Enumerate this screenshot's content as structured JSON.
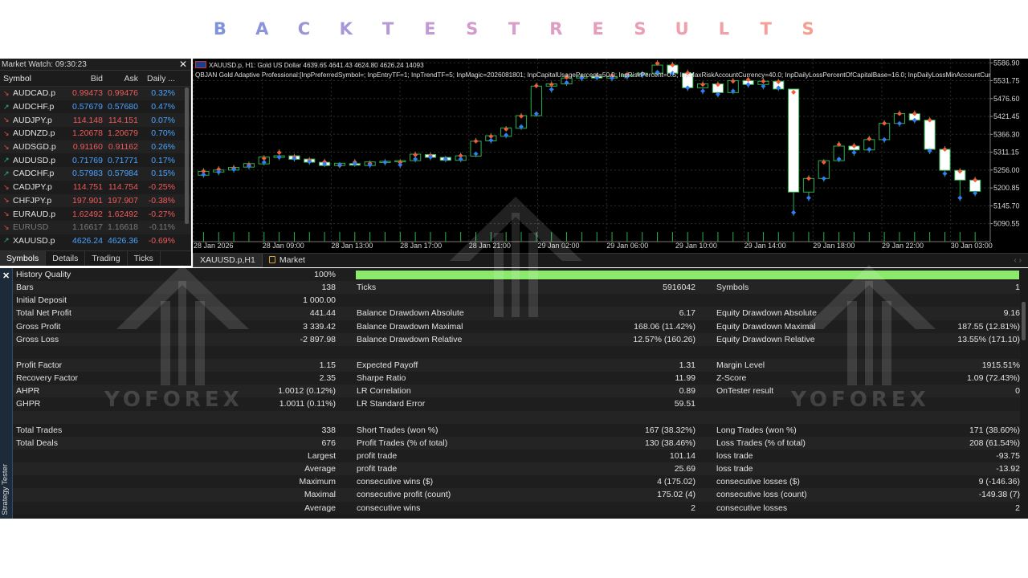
{
  "banner": {
    "letters": [
      "B",
      "A",
      "C",
      "K",
      "T",
      "E",
      "S",
      "T",
      "R",
      "E",
      "S",
      "U",
      "L",
      "T",
      "S"
    ],
    "colors": [
      "#7f93d8",
      "#8b94d8",
      "#9a95d8",
      "#a897d8",
      "#b598d6",
      "#c49ad4",
      "#d19bd0",
      "#d99ccb",
      "#e09dc4",
      "#e69ebd",
      "#eb9fb5",
      "#efa0ac",
      "#f2a0a3",
      "#f4a09a",
      "#f59f91"
    ]
  },
  "market_watch": {
    "title": "Market Watch: 09:30:23",
    "close": "✕",
    "headers": [
      "Symbol",
      "Bid",
      "Ask",
      "Daily ..."
    ],
    "rows": [
      {
        "dir": "dn",
        "symbol": "AUDCAD.p",
        "bid": "0.99473",
        "ask": "0.99476",
        "daily": "0.32%",
        "bidc": "neg",
        "askc": "neg",
        "dc": "pos"
      },
      {
        "dir": "up",
        "symbol": "AUDCHF.p",
        "bid": "0.57679",
        "ask": "0.57680",
        "daily": "0.47%",
        "bidc": "pos",
        "askc": "pos",
        "dc": "pos"
      },
      {
        "dir": "dn",
        "symbol": "AUDJPY.p",
        "bid": "114.148",
        "ask": "114.151",
        "daily": "0.07%",
        "bidc": "neg",
        "askc": "neg",
        "dc": "pos"
      },
      {
        "dir": "dn",
        "symbol": "AUDNZD.p",
        "bid": "1.20678",
        "ask": "1.20679",
        "daily": "0.70%",
        "bidc": "neg",
        "askc": "neg",
        "dc": "pos"
      },
      {
        "dir": "dn",
        "symbol": "AUDSGD.p",
        "bid": "0.91160",
        "ask": "0.91162",
        "daily": "0.26%",
        "bidc": "neg",
        "askc": "neg",
        "dc": "pos"
      },
      {
        "dir": "up",
        "symbol": "AUDUSD.p",
        "bid": "0.71769",
        "ask": "0.71771",
        "daily": "0.17%",
        "bidc": "pos",
        "askc": "pos",
        "dc": "pos"
      },
      {
        "dir": "up",
        "symbol": "CADCHF.p",
        "bid": "0.57983",
        "ask": "0.57984",
        "daily": "0.15%",
        "bidc": "pos",
        "askc": "pos",
        "dc": "pos"
      },
      {
        "dir": "dn",
        "symbol": "CADJPY.p",
        "bid": "114.751",
        "ask": "114.754",
        "daily": "-0.25%",
        "bidc": "neg",
        "askc": "neg",
        "dc": "neg"
      },
      {
        "dir": "dn",
        "symbol": "CHFJPY.p",
        "bid": "197.901",
        "ask": "197.907",
        "daily": "-0.38%",
        "bidc": "neg",
        "askc": "neg",
        "dc": "neg"
      },
      {
        "dir": "dn",
        "symbol": "EURAUD.p",
        "bid": "1.62492",
        "ask": "1.62492",
        "daily": "-0.27%",
        "bidc": "neg",
        "askc": "neg",
        "dc": "neg"
      },
      {
        "dir": "dn",
        "symbol": "EURUSD",
        "bid": "1.16617",
        "ask": "1.16618",
        "daily": "-0.11%",
        "bidc": "neg",
        "askc": "neg",
        "dc": "neg",
        "dim": true
      },
      {
        "dir": "up",
        "symbol": "XAUUSD.p",
        "bid": "4626.24",
        "ask": "4626.36",
        "daily": "-0.69%",
        "bidc": "pos",
        "askc": "pos",
        "dc": "neg"
      }
    ],
    "tabs": [
      "Symbols",
      "Details",
      "Trading",
      "Ticks"
    ]
  },
  "chart": {
    "info_line1": "XAUUSD.p, H1:  Gold US Dollar  4639.65 4641.43 4624.80 4626.24  14093",
    "info_line2": "QBJAN Gold Adaptive Professional:[InpPreferredSymbol=; InpEntryTF=1; InpTrendTF=5; InpMagic=2026081801; InpCapitalUsagePercent=50.0; InpRiskPercent=0.5; InpMaxRiskAccountCurrency=40.0; InpDailyLossPercentOfCapitalBase=16.0; InpDailyLossMinAccountCurr",
    "price_labels": [
      "5586.90",
      "5531.75",
      "5476.60",
      "5421.45",
      "5366.30",
      "5311.15",
      "5256.00",
      "5200.85",
      "5145.70",
      "5090.55"
    ],
    "time_labels": [
      "28 Jan 2026",
      "28 Jan 09:00",
      "28 Jan 13:00",
      "28 Jan 17:00",
      "28 Jan 21:00",
      "29 Jan 02:00",
      "29 Jan 06:00",
      "29 Jan 10:00",
      "29 Jan 14:00",
      "29 Jan 18:00",
      "29 Jan 22:00",
      "30 Jan 03:00"
    ],
    "tabs": [
      "XAUUSD.p,H1",
      "Market"
    ],
    "nav_arrows": "‹  ›"
  },
  "chart_data": {
    "type": "candlestick",
    "ylim": [
      5035,
      5600
    ],
    "candles": [
      [
        5240,
        5262,
        5232,
        5252
      ],
      [
        5250,
        5268,
        5240,
        5256
      ],
      [
        5256,
        5272,
        5248,
        5264
      ],
      [
        5265,
        5282,
        5258,
        5276
      ],
      [
        5275,
        5302,
        5270,
        5296
      ],
      [
        5295,
        5320,
        5286,
        5300
      ],
      [
        5300,
        5306,
        5282,
        5289
      ],
      [
        5290,
        5296,
        5272,
        5280
      ],
      [
        5280,
        5291,
        5265,
        5270
      ],
      [
        5270,
        5280,
        5262,
        5277
      ],
      [
        5276,
        5290,
        5266,
        5271
      ],
      [
        5270,
        5286,
        5262,
        5281
      ],
      [
        5280,
        5290,
        5270,
        5283
      ],
      [
        5283,
        5290,
        5262,
        5285
      ],
      [
        5285,
        5313,
        5280,
        5305
      ],
      [
        5304,
        5310,
        5286,
        5295
      ],
      [
        5295,
        5300,
        5280,
        5286
      ],
      [
        5286,
        5310,
        5280,
        5300
      ],
      [
        5299,
        5355,
        5296,
        5345
      ],
      [
        5346,
        5370,
        5338,
        5362
      ],
      [
        5360,
        5392,
        5354,
        5386
      ],
      [
        5385,
        5432,
        5380,
        5424
      ],
      [
        5424,
        5526,
        5420,
        5515
      ],
      [
        5515,
        5530,
        5495,
        5522
      ],
      [
        5522,
        5552,
        5516,
        5540
      ],
      [
        5540,
        5552,
        5530,
        5545
      ],
      [
        5545,
        5556,
        5532,
        5540
      ],
      [
        5540,
        5558,
        5530,
        5545
      ],
      [
        5545,
        5560,
        5535,
        5550
      ],
      [
        5550,
        5562,
        5540,
        5555
      ],
      [
        5555,
        5595,
        5548,
        5580
      ],
      [
        5580,
        5590,
        5545,
        5555
      ],
      [
        5555,
        5566,
        5500,
        5510
      ],
      [
        5510,
        5530,
        5490,
        5522
      ],
      [
        5522,
        5530,
        5480,
        5495
      ],
      [
        5495,
        5540,
        5490,
        5532
      ],
      [
        5532,
        5545,
        5510,
        5520
      ],
      [
        5520,
        5540,
        5505,
        5530
      ],
      [
        5530,
        5538,
        5500,
        5506
      ],
      [
        5506,
        5506,
        5115,
        5188
      ],
      [
        5188,
        5240,
        5160,
        5230
      ],
      [
        5230,
        5290,
        5220,
        5285
      ],
      [
        5285,
        5345,
        5280,
        5330
      ],
      [
        5330,
        5340,
        5300,
        5318
      ],
      [
        5318,
        5362,
        5310,
        5350
      ],
      [
        5350,
        5410,
        5340,
        5400
      ],
      [
        5400,
        5440,
        5390,
        5430
      ],
      [
        5430,
        5440,
        5400,
        5410
      ],
      [
        5410,
        5420,
        5305,
        5320
      ],
      [
        5320,
        5330,
        5235,
        5255
      ],
      [
        5255,
        5262,
        5160,
        5225
      ],
      [
        5225,
        5235,
        5175,
        5190
      ]
    ],
    "bull_color": "#2bb24c",
    "bear_color": "#ffffff",
    "marker_colors": [
      "#f25a3a",
      "#2f7df6"
    ]
  },
  "tester": {
    "side_label": "Strategy Tester",
    "close": "✕",
    "rows": [
      [
        "History Quality",
        "100%",
        "",
        "",
        "",
        ""
      ],
      [
        "Bars",
        "138",
        "Ticks",
        "5916042",
        "Symbols",
        "1"
      ],
      [
        "Initial Deposit",
        "1 000.00",
        "",
        "",
        "",
        ""
      ],
      [
        "Total Net Profit",
        "441.44",
        "Balance Drawdown Absolute",
        "6.17",
        "Equity Drawdown Absolute",
        "9.16"
      ],
      [
        "Gross Profit",
        "3 339.42",
        "Balance Drawdown Maximal",
        "168.06 (11.42%)",
        "Equity Drawdown Maximal",
        "187.55 (12.81%)"
      ],
      [
        "Gross Loss",
        "-2 897.98",
        "Balance Drawdown Relative",
        "12.57% (160.26)",
        "Equity Drawdown Relative",
        "13.55% (171.10)"
      ],
      [
        "",
        "",
        "",
        "",
        "",
        ""
      ],
      [
        "Profit Factor",
        "1.15",
        "Expected Payoff",
        "1.31",
        "Margin Level",
        "1915.51%"
      ],
      [
        "Recovery Factor",
        "2.35",
        "Sharpe Ratio",
        "11.99",
        "Z-Score",
        "1.09 (72.43%)"
      ],
      [
        "AHPR",
        "1.0012 (0.12%)",
        "LR Correlation",
        "0.89",
        "OnTester result",
        "0"
      ],
      [
        "GHPR",
        "1.0011 (0.11%)",
        "LR Standard Error",
        "59.51",
        "",
        ""
      ],
      [
        "",
        "",
        "",
        "",
        "",
        ""
      ],
      [
        "Total Trades",
        "338",
        "Short Trades (won %)",
        "167 (38.32%)",
        "Long Trades (won %)",
        "171 (38.60%)"
      ],
      [
        "Total Deals",
        "676",
        "Profit Trades (% of total)",
        "130 (38.46%)",
        "Loss Trades (% of total)",
        "208 (61.54%)"
      ],
      [
        "",
        "Largest",
        "profit trade",
        "101.14",
        "loss trade",
        "-93.75"
      ],
      [
        "",
        "Average",
        "profit trade",
        "25.69",
        "loss trade",
        "-13.92"
      ],
      [
        "",
        "Maximum",
        "consecutive wins ($)",
        "4 (175.02)",
        "consecutive losses ($)",
        "9 (-146.36)"
      ],
      [
        "",
        "Maximal",
        "consecutive profit (count)",
        "175.02 (4)",
        "consecutive loss (count)",
        "-149.38 (7)"
      ],
      [
        "",
        "Average",
        "consecutive wins",
        "2",
        "consecutive losses",
        "2"
      ]
    ],
    "history_quality_fill": 1.0
  },
  "watermark": {
    "text": "YOFOREX"
  }
}
